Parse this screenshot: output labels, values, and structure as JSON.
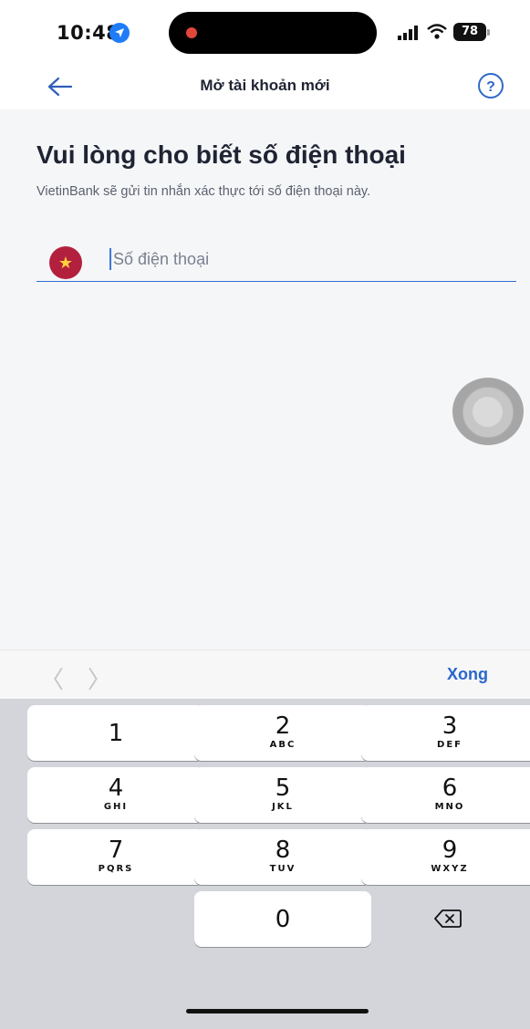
{
  "status_bar": {
    "time": "10:48",
    "battery": "78"
  },
  "nav": {
    "title": "Mở tài khoản mới",
    "help_symbol": "?"
  },
  "content": {
    "heading": "Vui lòng cho biết số điện thoại",
    "subtext": "VietinBank sẽ gửi tin nhắn xác thực tới số điện thoại này.",
    "phone_placeholder": "Số điện thoại",
    "phone_value": ""
  },
  "accessory": {
    "prev": "〈",
    "next": "〉",
    "done_label": "Xong"
  },
  "keypad": {
    "keys": [
      {
        "num": "1",
        "letters": ""
      },
      {
        "num": "2",
        "letters": "ABC"
      },
      {
        "num": "3",
        "letters": "DEF"
      },
      {
        "num": "4",
        "letters": "GHI"
      },
      {
        "num": "5",
        "letters": "JKL"
      },
      {
        "num": "6",
        "letters": "MNO"
      },
      {
        "num": "7",
        "letters": "PQRS"
      },
      {
        "num": "8",
        "letters": "TUV"
      },
      {
        "num": "9",
        "letters": "WXYZ"
      },
      {
        "num": "0",
        "letters": ""
      }
    ]
  },
  "colors": {
    "accent": "#2a66cc",
    "flag_red": "#b3203e",
    "flag_star": "#ffd23a"
  }
}
